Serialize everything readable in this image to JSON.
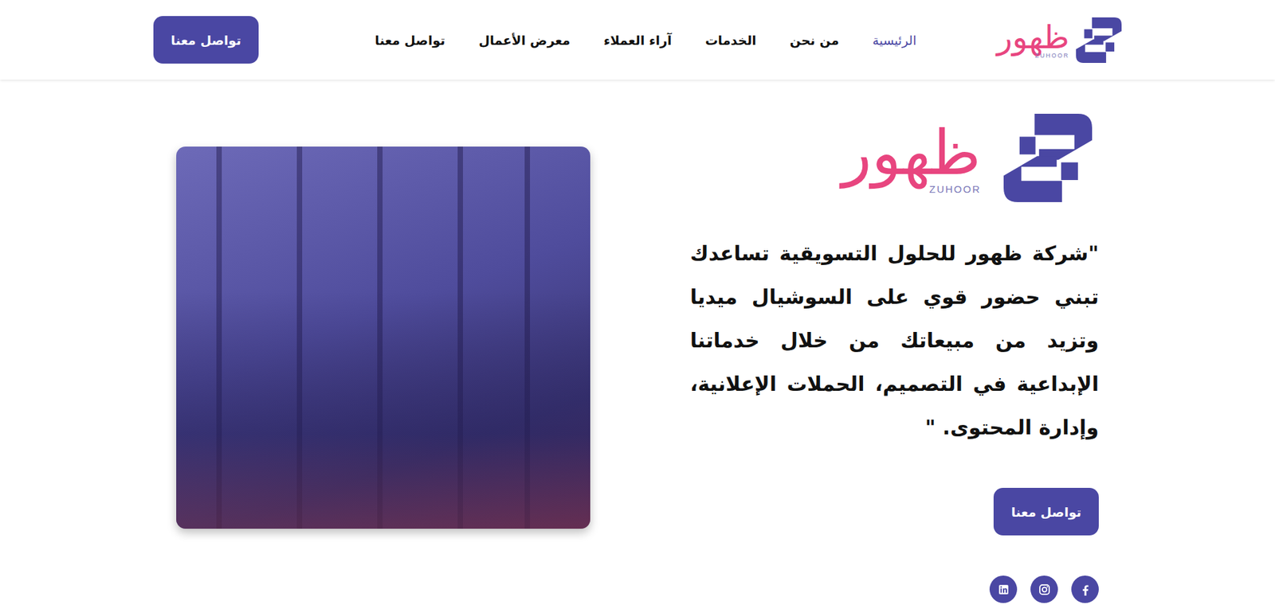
{
  "header": {
    "logo": {
      "arabic": "ظهور",
      "latin": "ZUHOOR"
    },
    "nav": [
      {
        "label": "الرئيسية",
        "selected": true
      },
      {
        "label": "من نحن",
        "selected": false
      },
      {
        "label": "الخدمات",
        "selected": false
      },
      {
        "label": "آراء العملاء",
        "selected": false
      },
      {
        "label": "معرض الأعمال",
        "selected": false
      },
      {
        "label": "تواصل معنا",
        "selected": false
      }
    ],
    "cta": "تواصل معنا"
  },
  "hero": {
    "logo": {
      "arabic": "ظهور",
      "latin": "ZUHOOR"
    },
    "tagline": "\"شركة ظهور للحلول التسويقية تساعدك تبني حضور قوي على السوشيال ميديا وتزيد من مبيعاتك من خلال خدماتنا الإبداعية في التصميم، الحملات الإعلانية، وإدارة المحتوى. \"",
    "cta": "تواصل معنا"
  }
}
